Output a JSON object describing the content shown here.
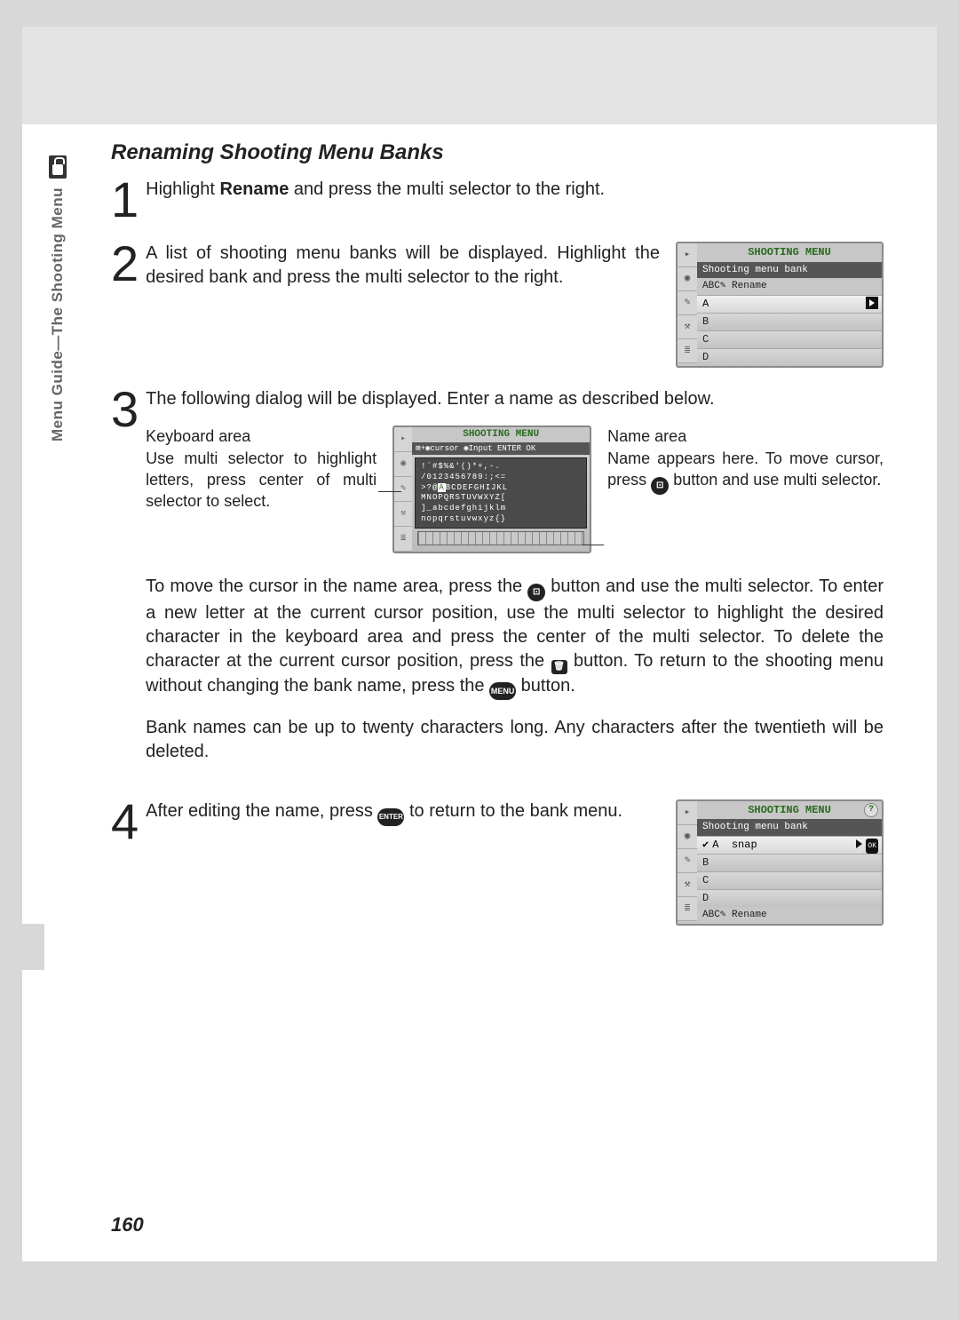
{
  "sidebar_label": "Menu Guide—The Shooting Menu",
  "section_title": "Renaming Shooting Menu Banks",
  "step1": {
    "num": "1",
    "text_pre": "Highlight ",
    "text_bold": "Rename",
    "text_post": " and press the multi selector to the right."
  },
  "step2": {
    "num": "2",
    "text": "A list of shooting menu banks will be displayed. Highlight the desired bank and press the multi selector to the right.",
    "screen": {
      "title": "SHOOTING MENU",
      "subtitle": "Shooting menu bank",
      "rename_label": "ABC✎ Rename",
      "rows": [
        "A",
        "B",
        "C",
        "D"
      ]
    }
  },
  "step3": {
    "num": "3",
    "intro": "The following dialog will be displayed. Enter a name as described below.",
    "keyboard_area": {
      "heading": "Keyboard area",
      "body": "Use multi selector to highlight letters, press center of multi selector to select."
    },
    "name_area": {
      "heading": "Name area",
      "body_pre": "Name appears here. To move cursor, press ",
      "body_post": " button and use multi selector."
    },
    "kbd_screen": {
      "title": "SHOOTING MENU",
      "bar": "⊠+◉cursor ◉Input  ENTER OK",
      "rows": [
        "!´#$%&'()*+,-.",
        "/0123456789:;<=",
        ">?@ABCDEFGHIJKL",
        "MNOPQRSTUVWXYZ[",
        "]_abcdefghijklm",
        "nopqrstuvwxyz{}"
      ],
      "highlight": "A"
    },
    "para1_parts": {
      "p1": "To move the cursor in the name area, press the ",
      "p2": " button and use the multi selector. To enter a new letter at the current cursor position, use the multi selector to highlight the desired character in the keyboard area and press the center of the multi selector. To delete the character at the current cursor position, press the ",
      "p3": " button. To return to the shooting menu without changing the bank name, press the ",
      "p4": " button."
    },
    "para2": "Bank names can be up to twenty characters long. Any characters after the twentieth will be deleted."
  },
  "step4": {
    "num": "4",
    "text_pre": "After editing the name, press ",
    "text_post": " to return to the bank menu.",
    "screen": {
      "title": "SHOOTING MENU",
      "subtitle": "Shooting menu bank",
      "rows": [
        {
          "label": "A",
          "name": "snap",
          "checked": true,
          "ok": true
        },
        {
          "label": "B"
        },
        {
          "label": "C"
        },
        {
          "label": "D"
        }
      ],
      "rename_label": "ABC✎ Rename"
    }
  },
  "icons": {
    "thumbnail": "⊡",
    "trash": "🗑",
    "menu": "MENU",
    "enter": "ENTER"
  },
  "page_number": "160"
}
